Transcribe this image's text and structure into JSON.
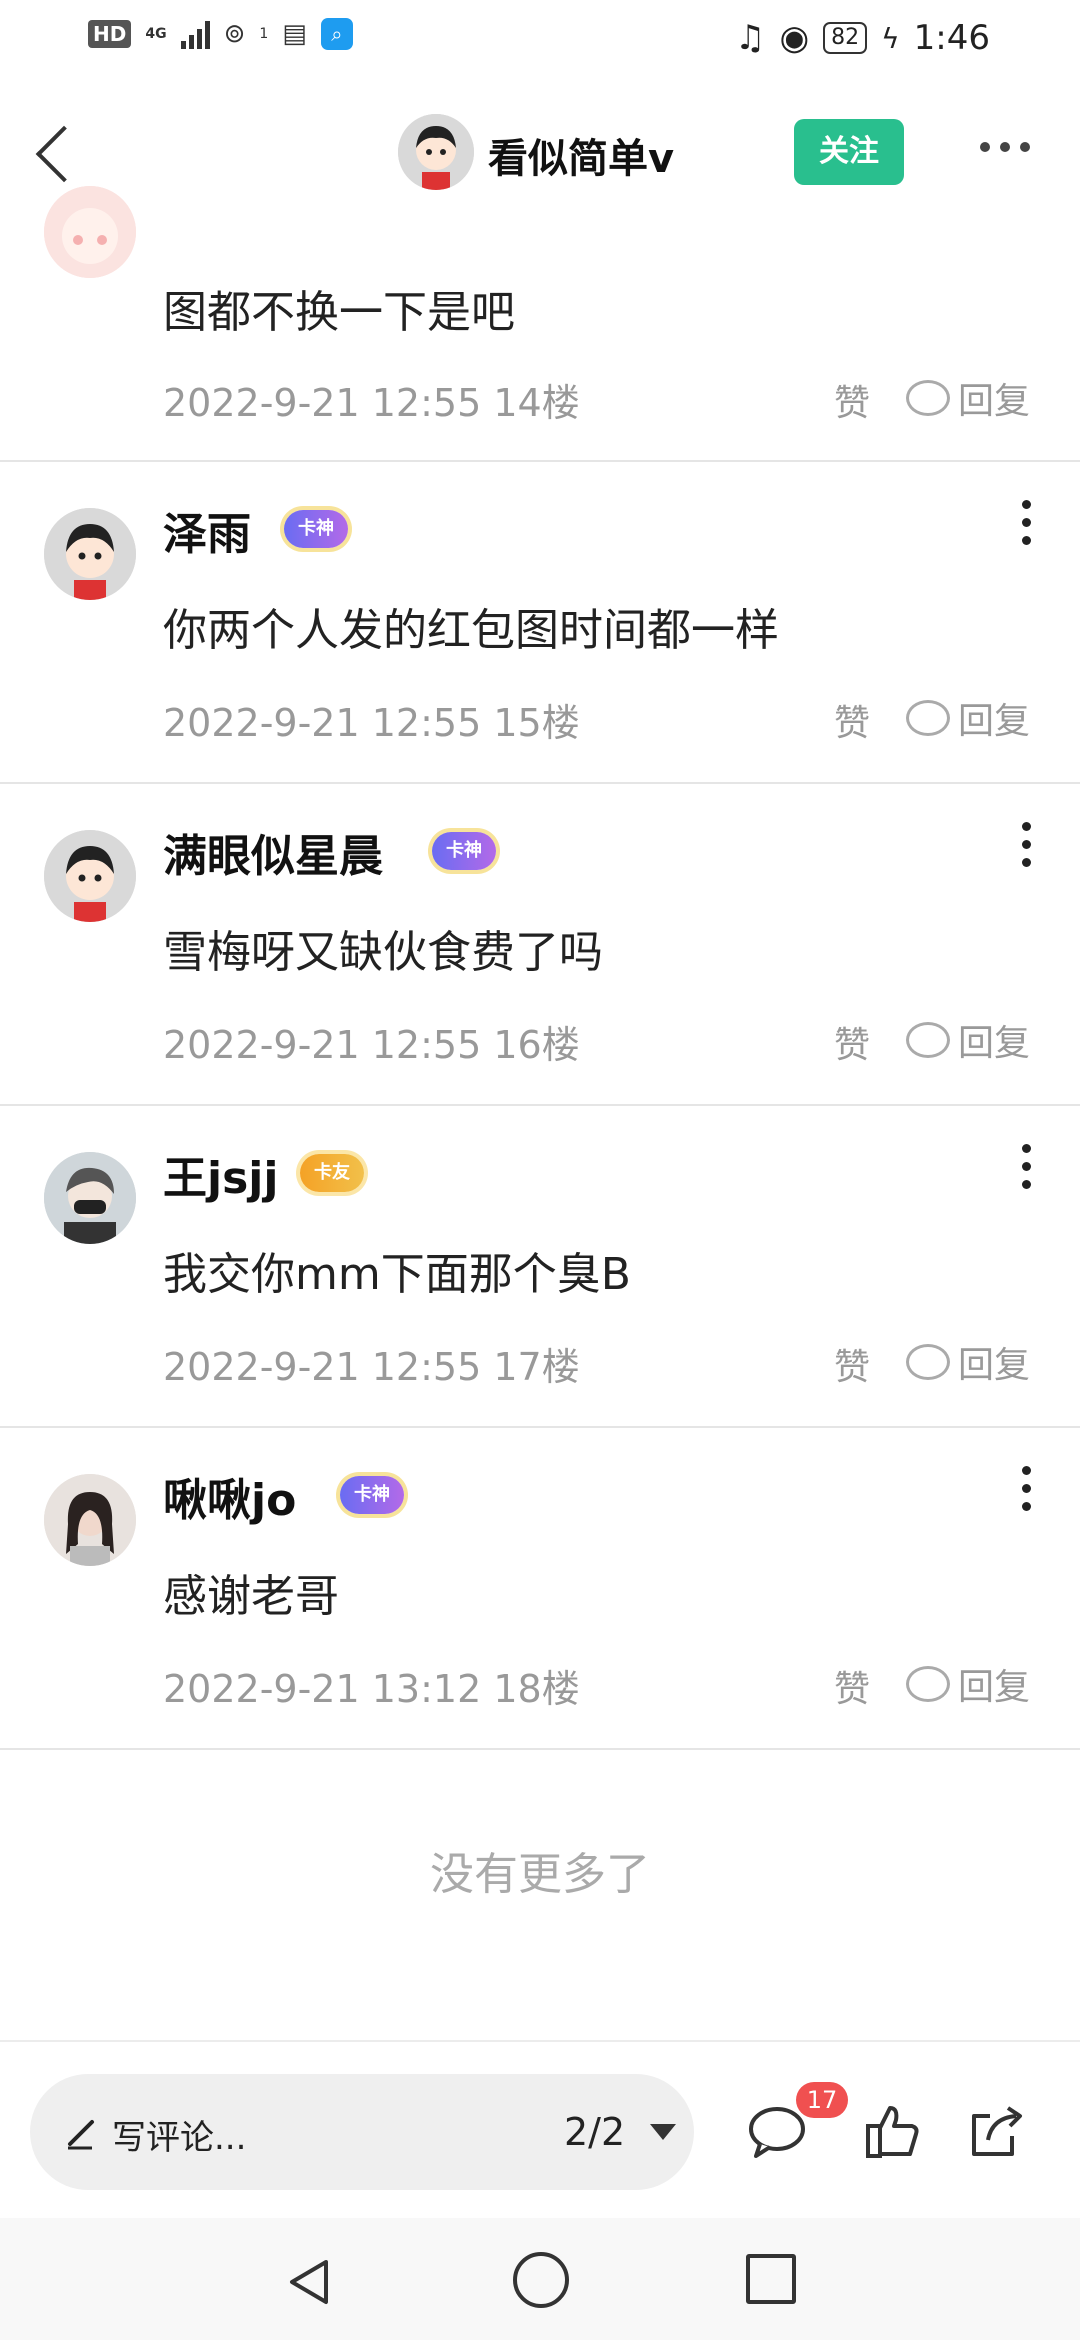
{
  "status_bar": {
    "hd_label": "HD",
    "network_label": "4G",
    "hotspot_count": "1",
    "battery_level": "82",
    "time": "1:46"
  },
  "header": {
    "title": "看似简单v",
    "follow_label": "关注"
  },
  "comments": [
    {
      "username": "",
      "badge": "",
      "text": "图都不换一下是吧",
      "date": "2022-9-21 12:55",
      "floor": "14楼",
      "like_label": "赞",
      "reply_label": "回复"
    },
    {
      "username": "泽雨",
      "badge": "卡神",
      "text": "你两个人发的红包图时间都一样",
      "date": "2022-9-21 12:55",
      "floor": "15楼",
      "like_label": "赞",
      "reply_label": "回复"
    },
    {
      "username": "满眼似星晨",
      "badge": "卡神",
      "text": "雪梅呀又缺伙食费了吗",
      "date": "2022-9-21 12:55",
      "floor": "16楼",
      "like_label": "赞",
      "reply_label": "回复"
    },
    {
      "username": "王jsjj",
      "badge": "卡友",
      "text": "我交你mm下面那个臭B",
      "date": "2022-9-21 12:55",
      "floor": "17楼",
      "like_label": "赞",
      "reply_label": "回复"
    },
    {
      "username": "啾啾jo",
      "badge": "卡神",
      "text": "感谢老哥",
      "date": "2022-9-21 13:12",
      "floor": "18楼",
      "like_label": "赞",
      "reply_label": "回复"
    }
  ],
  "end_text": "没有更多了",
  "bottom_bar": {
    "input_placeholder": "写评论...",
    "page_indicator": "2/2",
    "comment_count": "17"
  }
}
